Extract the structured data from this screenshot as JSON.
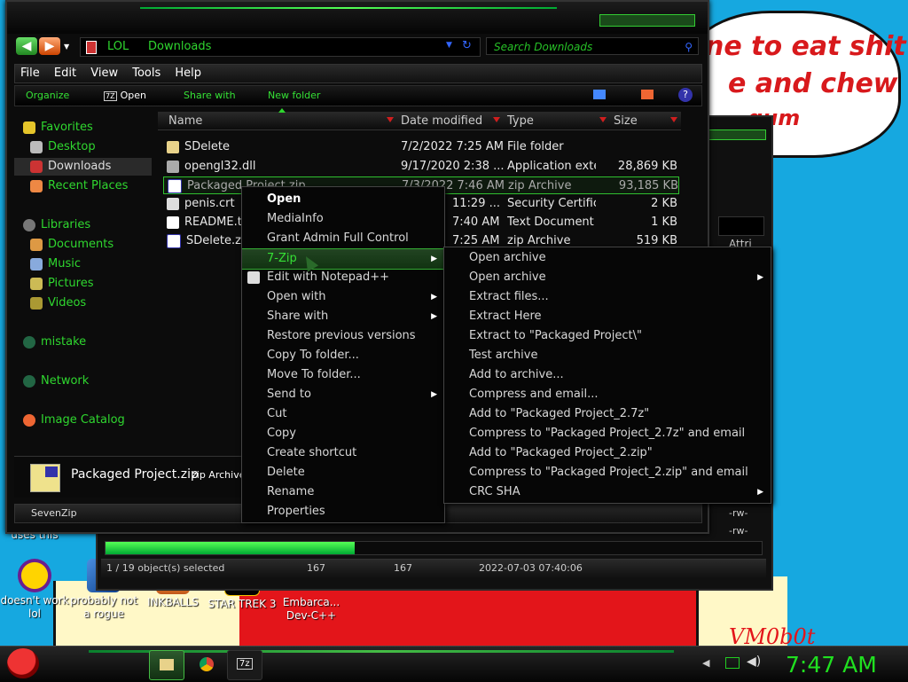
{
  "wallpaper": {
    "bubble_lines": [
      "ne to eat shit",
      "e and chew",
      "gum"
    ],
    "signature": "VM0b0t"
  },
  "desktop_icons": [
    {
      "label": "uses this",
      "icon": "partial-icon"
    },
    {
      "label": "doesn't work lol",
      "icon": "yahoo-messenger-icon"
    },
    {
      "label": "probably not a rogue",
      "icon": "program-icon"
    },
    {
      "label": "INKBALLS",
      "icon": "inkballs-icon"
    },
    {
      "label": "STAR TREK 3",
      "icon": "star-wars-icon"
    },
    {
      "label": "Embarca... Dev-C++",
      "icon": "devcpp-icon"
    }
  ],
  "explorer": {
    "address": {
      "root": "LOL",
      "folder": "Downloads"
    },
    "search_placeholder": "Search Downloads",
    "menu": [
      "File",
      "Edit",
      "View",
      "Tools",
      "Help"
    ],
    "commands": {
      "organize": "Organize",
      "open": "Open",
      "share": "Share with",
      "new_folder": "New folder"
    },
    "nav": {
      "favorites": "Favorites",
      "desktop": "Desktop",
      "downloads": "Downloads",
      "recent": "Recent Places",
      "libraries": "Libraries",
      "documents": "Documents",
      "music": "Music",
      "pictures": "Pictures",
      "videos": "Videos",
      "mistake": "mistake",
      "network": "Network",
      "image_catalog": "Image Catalog"
    },
    "columns": {
      "name": "Name",
      "date": "Date modified",
      "type": "Type",
      "size": "Size"
    },
    "files": [
      {
        "name": "SDelete",
        "date": "7/2/2022 7:25 AM",
        "type": "File folder",
        "size": ""
      },
      {
        "name": "opengl32.dll",
        "date": "9/17/2020 2:38 ...",
        "type": "Application exte...",
        "size": "28,869 KB"
      },
      {
        "name": "Packaged Project.zip",
        "date": "7/3/2022 7:46 AM",
        "type": "zip Archive",
        "size": "93,185 KB"
      },
      {
        "name": "penis.crt",
        "date": "11:29 ...",
        "type": "Security Certific...",
        "size": "2 KB"
      },
      {
        "name": "README.t",
        "date": "7:40 AM",
        "type": "Text Document",
        "size": "1 KB"
      },
      {
        "name": "SDelete.zi",
        "date": "7:25 AM",
        "type": "zip Archive",
        "size": "519 KB"
      }
    ],
    "details": {
      "name": "Packaged Project.zip",
      "type": "zip Archive"
    },
    "status": "SevenZip"
  },
  "back_window": {
    "selection": "1 / 19 object(s) selected",
    "size1": "167",
    "size2": "167",
    "datetime": "2022-07-03 07:40:06",
    "attr_label": "Attri",
    "rw": [
      "-rw-",
      "-rw-"
    ]
  },
  "context_menu": [
    {
      "label": "Open",
      "bold": true
    },
    {
      "label": "MediaInfo"
    },
    {
      "label": "Grant Admin Full Control"
    },
    {
      "label": "7-Zip",
      "submenu": true,
      "highlight": true
    },
    {
      "label": "Edit with Notepad++",
      "icon": true
    },
    {
      "label": "Open with",
      "submenu": true
    },
    {
      "label": "Share with",
      "submenu": true
    },
    {
      "label": "Restore previous versions"
    },
    {
      "label": "Copy To folder..."
    },
    {
      "label": "Move To folder..."
    },
    {
      "label": "Send to",
      "submenu": true
    },
    {
      "label": "Cut"
    },
    {
      "label": "Copy"
    },
    {
      "label": "Create shortcut"
    },
    {
      "label": "Delete"
    },
    {
      "label": "Rename"
    },
    {
      "label": "Properties"
    }
  ],
  "zip_menu": [
    {
      "label": "Open archive"
    },
    {
      "label": "Open archive",
      "submenu": true
    },
    {
      "label": "Extract files..."
    },
    {
      "label": "Extract Here"
    },
    {
      "label": "Extract to \"Packaged Project\\\""
    },
    {
      "label": "Test archive"
    },
    {
      "label": "Add to archive..."
    },
    {
      "label": "Compress and email..."
    },
    {
      "label": "Add to \"Packaged Project_2.7z\""
    },
    {
      "label": "Compress to \"Packaged Project_2.7z\" and email"
    },
    {
      "label": "Add to \"Packaged Project_2.zip\""
    },
    {
      "label": "Compress to \"Packaged Project_2.zip\" and email"
    },
    {
      "label": "CRC SHA",
      "submenu": true
    }
  ],
  "taskbar": {
    "clock": "7:47 AM",
    "seven_zip_label": "7z"
  },
  "colors": {
    "accent_green": "#2fd72f",
    "brand_red": "#e3151a",
    "sky": "#16a8e0"
  }
}
